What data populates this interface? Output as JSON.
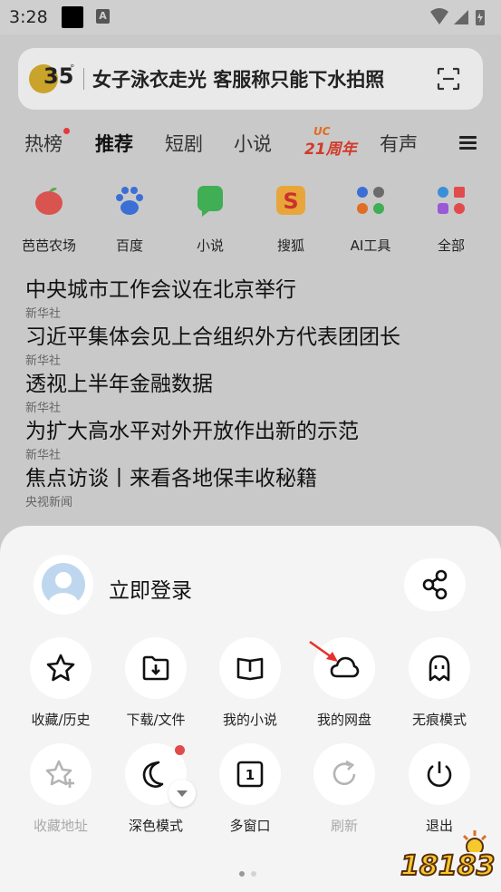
{
  "status_bar": {
    "time": "3:28",
    "badge_letter": "A"
  },
  "search": {
    "temperature": "35",
    "degree": "°",
    "headline": "女子泳衣走光 客服称只能下水拍照"
  },
  "tabs": [
    {
      "label": "热榜"
    },
    {
      "label": "推荐"
    },
    {
      "label": "短剧"
    },
    {
      "label": "小说"
    },
    {
      "label": "有声"
    }
  ],
  "uc_badge": {
    "top": "UC",
    "main": "21周年"
  },
  "shortcuts": [
    {
      "label": "芭芭农场",
      "icon": "apple-icon"
    },
    {
      "label": "百度",
      "icon": "baidu-paw-icon"
    },
    {
      "label": "小说",
      "icon": "novel-book-icon"
    },
    {
      "label": "搜狐",
      "icon": "sohu-icon"
    },
    {
      "label": "AI工具",
      "icon": "ai-tools-icon"
    },
    {
      "label": "全部",
      "icon": "all-apps-icon"
    }
  ],
  "news": [
    {
      "title": "中央城市工作会议在北京举行",
      "source": "新华社"
    },
    {
      "title": "习近平集体会见上合组织外方代表团团长",
      "source": "新华社"
    },
    {
      "title": "透视上半年金融数据",
      "source": "新华社"
    },
    {
      "title": "为扩大高水平对外开放作出新的示范",
      "source": "新华社"
    },
    {
      "title": "焦点访谈丨来看各地保丰收秘籍",
      "source": "央视新闻"
    }
  ],
  "sheet": {
    "login_label": "立即登录",
    "tools_row1": [
      {
        "label": "收藏/历史",
        "icon": "star-icon"
      },
      {
        "label": "下载/文件",
        "icon": "download-folder-icon"
      },
      {
        "label": "我的小说",
        "icon": "book-icon"
      },
      {
        "label": "我的网盘",
        "icon": "cloud-icon"
      },
      {
        "label": "无痕模式",
        "icon": "ghost-icon"
      }
    ],
    "tools_row2": [
      {
        "label": "收藏地址",
        "icon": "star-plus-icon"
      },
      {
        "label": "深色模式",
        "icon": "moon-icon"
      },
      {
        "label": "多窗口",
        "icon": "window-icon",
        "count": "1"
      },
      {
        "label": "刷新",
        "icon": "refresh-icon"
      },
      {
        "label": "退出",
        "icon": "power-icon"
      }
    ]
  },
  "watermark": {
    "text": "18183"
  },
  "colors": {
    "accent_red": "#e24b4b",
    "sheet_bg": "#f4f4f5",
    "dimmed_bg": "#c9c9c9"
  }
}
